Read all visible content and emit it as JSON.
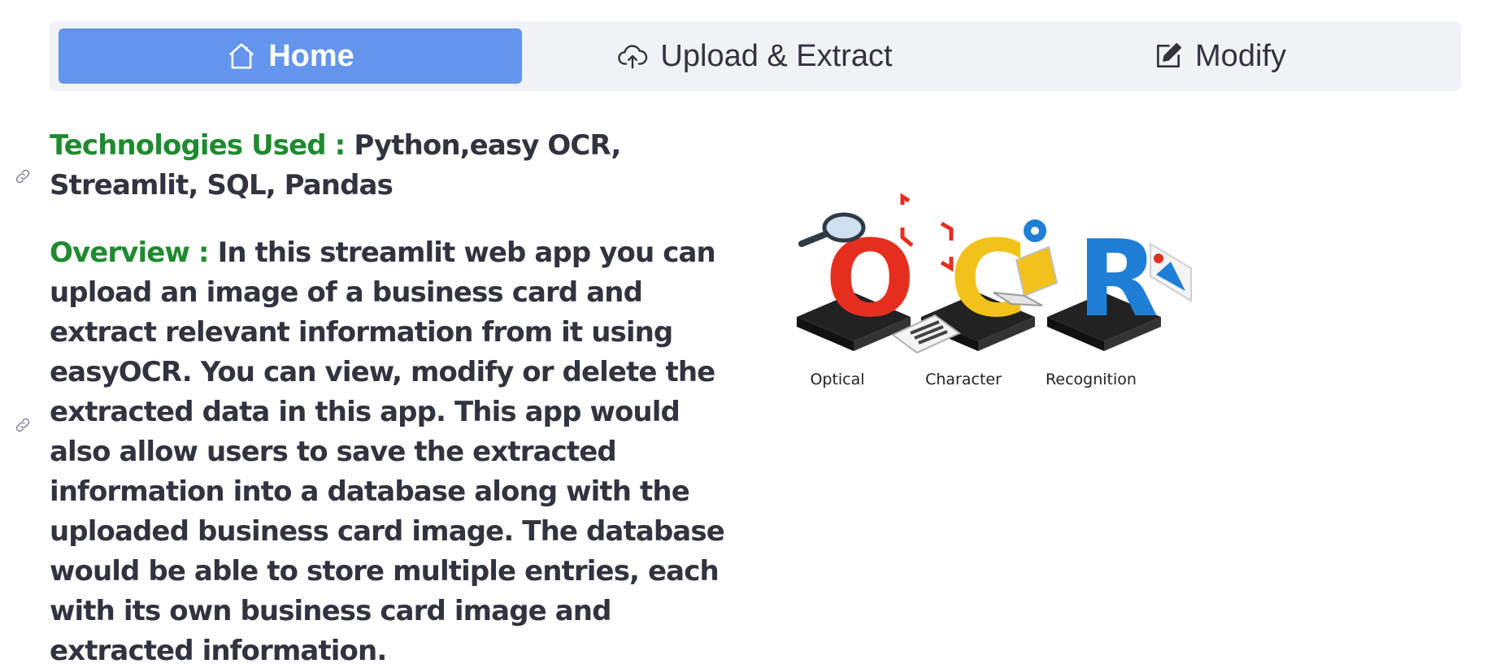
{
  "nav": {
    "items": [
      {
        "label": "Home",
        "icon": "home-icon",
        "active": true
      },
      {
        "label": "Upload & Extract",
        "icon": "cloud-upload-icon",
        "active": false
      },
      {
        "label": "Modify",
        "icon": "pencil-square-icon",
        "active": false
      }
    ],
    "active_color": "#6495ed",
    "bar_color": "#f0f2f6"
  },
  "content": {
    "technologies": {
      "label": "Technologies Used :",
      "text": "Python,easy OCR, Streamlit, SQL, Pandas"
    },
    "overview": {
      "label": "Overview :",
      "text": "In this streamlit web app you can upload an image of a business card and extract relevant information from it using easyOCR. You can view, modify or delete the extracted data in this app. This app would also allow users to save the extracted information into a database along with the uploaded business card image. The database would be able to store multiple entries, each with its own business card image and extracted information."
    },
    "label_color": "#1e8b2e",
    "text_color": "#31333f"
  },
  "illustration": {
    "captions": [
      "Optical",
      "Character",
      "Recognition"
    ],
    "letters": [
      "O",
      "C",
      "R"
    ],
    "letter_colors": [
      "#e62e1f",
      "#f2c21b",
      "#1f7fd6"
    ]
  }
}
